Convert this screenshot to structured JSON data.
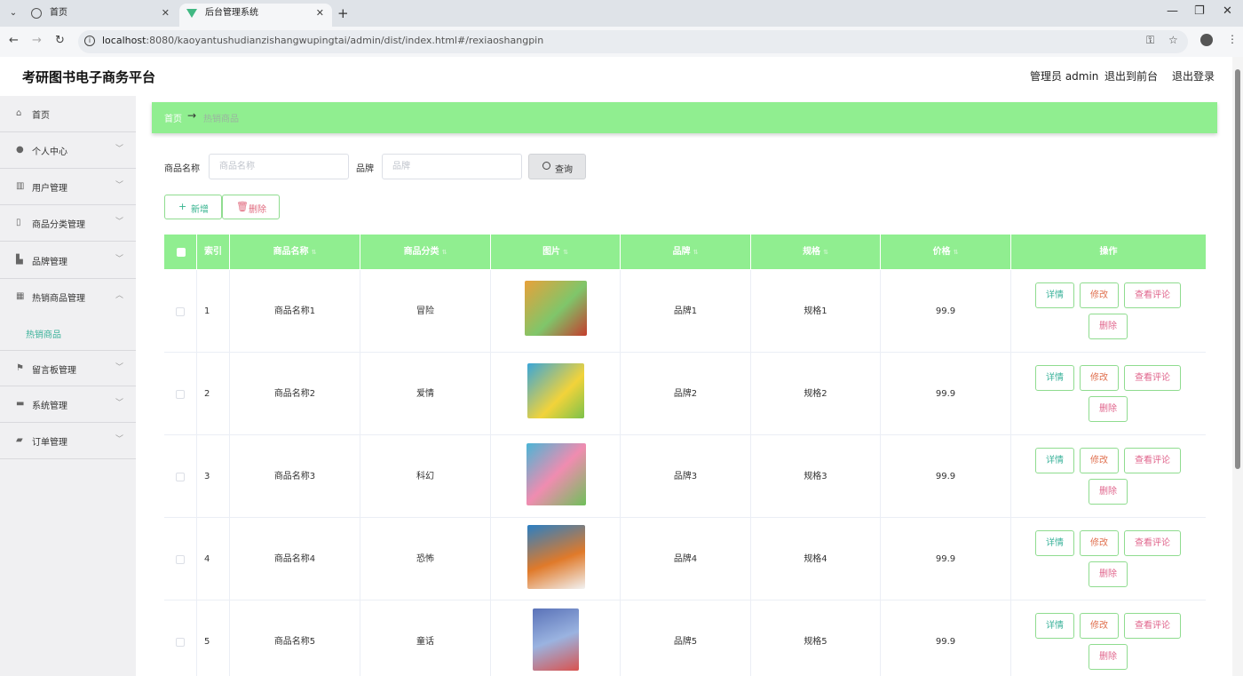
{
  "browser": {
    "tabs": [
      {
        "title": "首页"
      },
      {
        "title": "后台管理系统"
      }
    ],
    "url_host": "localhost",
    "url_rest": ":8080/kaoyantushudianzishangwupingtai/admin/dist/index.html#/rexiaoshangpin"
  },
  "header": {
    "site_title": "考研图书电子商务平台",
    "admin_label": "管理员 admin",
    "exit_front": "退出到前台",
    "logout": "退出登录"
  },
  "sidebar": {
    "items": [
      {
        "label": "首页",
        "icon": "home-icon"
      },
      {
        "label": "个人中心",
        "icon": "user-icon"
      },
      {
        "label": "用户管理",
        "icon": "users-icon"
      },
      {
        "label": "商品分类管理",
        "icon": "category-icon"
      },
      {
        "label": "品牌管理",
        "icon": "brand-icon"
      },
      {
        "label": "热销商品管理",
        "icon": "grid-icon"
      },
      {
        "label": "留言板管理",
        "icon": "flag-icon"
      },
      {
        "label": "系统管理",
        "icon": "system-icon"
      },
      {
        "label": "订单管理",
        "icon": "order-icon"
      }
    ],
    "sub_item": "热销商品"
  },
  "breadcrumb": {
    "home": "首页",
    "arrow": "→",
    "current": "热销商品"
  },
  "search": {
    "name_label": "商品名称",
    "name_placeholder": "商品名称",
    "brand_label": "品牌",
    "brand_placeholder": "品牌",
    "query_button": "查询"
  },
  "actions": {
    "add": "新增",
    "delete": "删除"
  },
  "table": {
    "headers": [
      "索引",
      "商品名称",
      "商品分类",
      "图片",
      "品牌",
      "规格",
      "价格",
      "操作"
    ],
    "rows": [
      {
        "index": "1",
        "name": "商品名称1",
        "category": "冒险",
        "brand": "品牌1",
        "spec": "规格1",
        "price": "99.9",
        "cover": "#e8a13a"
      },
      {
        "index": "2",
        "name": "商品名称2",
        "category": "爱情",
        "brand": "品牌2",
        "spec": "规格2",
        "price": "99.9",
        "cover": "#3aa6d8"
      },
      {
        "index": "3",
        "name": "商品名称3",
        "category": "科幻",
        "brand": "品牌3",
        "spec": "规格3",
        "price": "99.9",
        "cover": "#4ab5d6"
      },
      {
        "index": "4",
        "name": "商品名称4",
        "category": "恐怖",
        "brand": "品牌4",
        "spec": "规格4",
        "price": "99.9",
        "cover": "#e07a2a"
      },
      {
        "index": "5",
        "name": "商品名称5",
        "category": "童话",
        "brand": "品牌5",
        "spec": "规格5",
        "price": "99.9",
        "cover": "#5a72b8"
      }
    ],
    "ops": {
      "detail": "详情",
      "edit": "修改",
      "comments": "查看评论",
      "delete": "删除"
    }
  },
  "colors": {
    "accent_green": "#90ee90",
    "teal_text": "#3bb29a",
    "pink_text": "#e0658c"
  }
}
